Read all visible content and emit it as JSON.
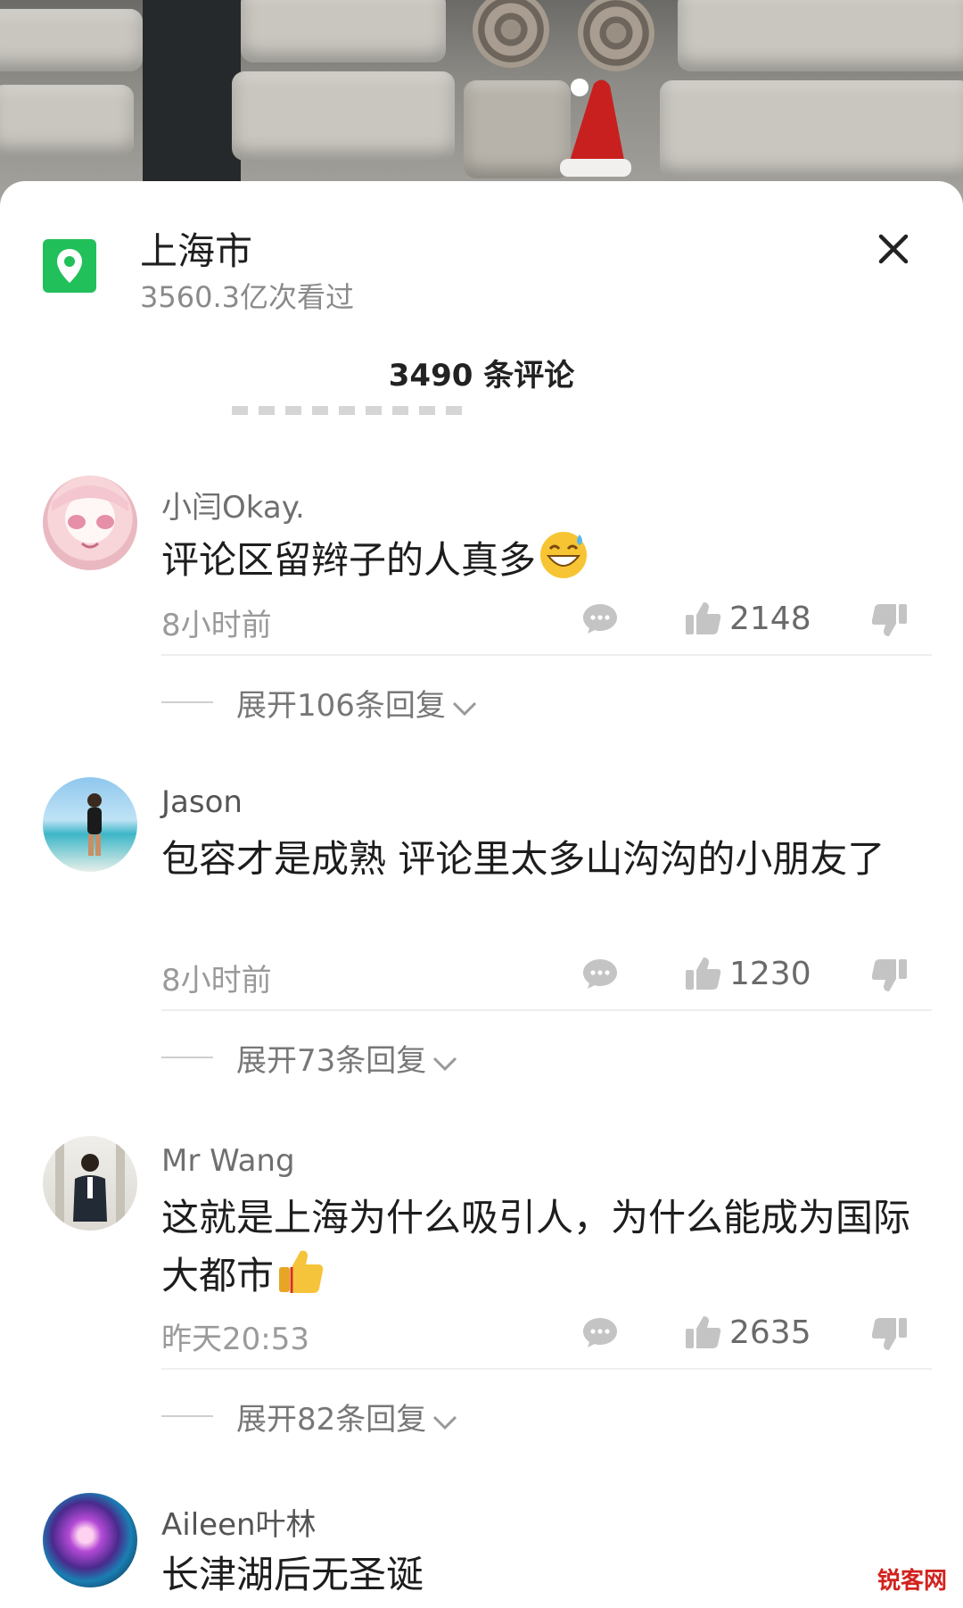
{
  "location": {
    "title": "上海市",
    "views": "3560.3亿次看过"
  },
  "comment_count": "3490 条评论",
  "comments": [
    {
      "user": "小闫Okay.",
      "text": "评论区留辫子的人真多",
      "emoji": "grinning-sweat-emoji",
      "time": "8小时前",
      "likes": "2148",
      "expand": "展开106条回复"
    },
    {
      "user": "Jason",
      "text": "包容才是成熟 评论里太多山沟沟的小朋友了",
      "time": "8小时前",
      "likes": "1230",
      "expand": "展开73条回复"
    },
    {
      "user": "Mr Wang",
      "text": "这就是上海为什么吸引人，为什么能成为国际大都市",
      "emoji": "thumbs-up-emoji",
      "time": "昨天20:53",
      "likes": "2635",
      "expand": "展开82条回复"
    },
    {
      "user": "Aileen叶林",
      "text": "长津湖后无圣诞"
    }
  ],
  "watermark": "锐客网",
  "colors": {
    "accent_green": "#22c05a",
    "watermark_red": "#d2221e"
  }
}
